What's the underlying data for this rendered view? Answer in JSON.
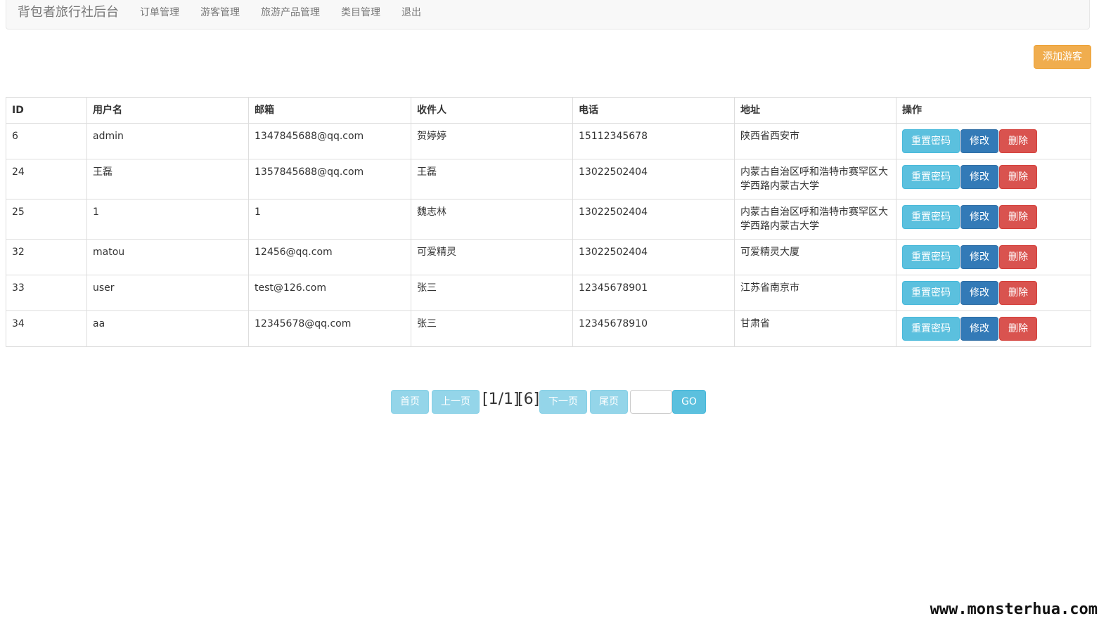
{
  "navbar": {
    "brand": "背包者旅行社后台",
    "items": [
      "订单管理",
      "游客管理",
      "旅游产品管理",
      "类目管理",
      "退出"
    ]
  },
  "toolbar": {
    "add_label": "添加游客"
  },
  "table": {
    "headers": [
      "ID",
      "用户名",
      "邮箱",
      "收件人",
      "电话",
      "地址",
      "操作"
    ],
    "rows": [
      {
        "id": "6",
        "username": "admin",
        "email": "1347845688@qq.com",
        "recipient": "贺婷婷",
        "phone": "15112345678",
        "address": "陕西省西安市"
      },
      {
        "id": "24",
        "username": "王磊",
        "email": "1357845688@qq.com",
        "recipient": "王磊",
        "phone": "13022502404",
        "address": "内蒙古自治区呼和浩特市赛罕区大学西路内蒙古大学"
      },
      {
        "id": "25",
        "username": "1",
        "email": "1",
        "recipient": "魏志林",
        "phone": "13022502404",
        "address": "内蒙古自治区呼和浩特市赛罕区大学西路内蒙古大学"
      },
      {
        "id": "32",
        "username": "matou",
        "email": "12456@qq.com",
        "recipient": "可爱精灵",
        "phone": "13022502404",
        "address": "可爱精灵大厦"
      },
      {
        "id": "33",
        "username": "user",
        "email": "test@126.com",
        "recipient": "张三",
        "phone": "12345678901",
        "address": "江苏省南京市"
      },
      {
        "id": "34",
        "username": "aa",
        "email": "12345678@qq.com",
        "recipient": "张三",
        "phone": "12345678910",
        "address": "甘肃省"
      }
    ],
    "actions": {
      "reset": "重置密码",
      "edit": "修改",
      "delete": "删除"
    }
  },
  "pager": {
    "first": "首页",
    "prev": "上一页",
    "page_info": "[1/1]",
    "total_info": "[6]",
    "next": "下一页",
    "last": "尾页",
    "go": "GO",
    "input_value": ""
  },
  "watermark": "www.monsterhua.com"
}
